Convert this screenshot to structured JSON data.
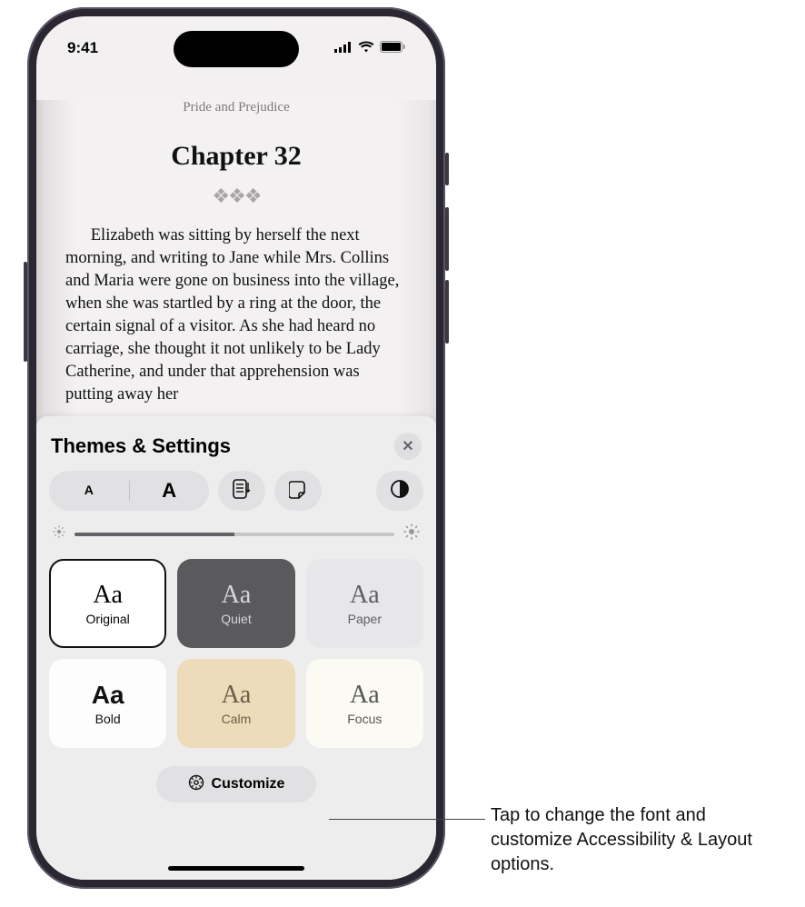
{
  "status": {
    "time": "9:41"
  },
  "book": {
    "title": "Pride and Prejudice",
    "chapter": "Chapter 32",
    "body": "Elizabeth was sitting by herself the next morning, and writing to Jane while Mrs. Collins and Maria were gone on business into the village, when she was startled by a ring at the door, the cer­tain signal of a visitor. As she had heard no carriage, she thought it not unlikely to be Lady Catherine, and under that apprehension was putting away her"
  },
  "sheet": {
    "title": "Themes & Settings",
    "font_small": "A",
    "font_large": "A",
    "themes": [
      {
        "aa": "Aa",
        "label": "Original"
      },
      {
        "aa": "Aa",
        "label": "Quiet"
      },
      {
        "aa": "Aa",
        "label": "Paper"
      },
      {
        "aa": "Aa",
        "label": "Bold"
      },
      {
        "aa": "Aa",
        "label": "Calm"
      },
      {
        "aa": "Aa",
        "label": "Focus"
      }
    ],
    "customize": "Customize"
  },
  "callout": "Tap to change the font and customize Accessibility & Layout options."
}
